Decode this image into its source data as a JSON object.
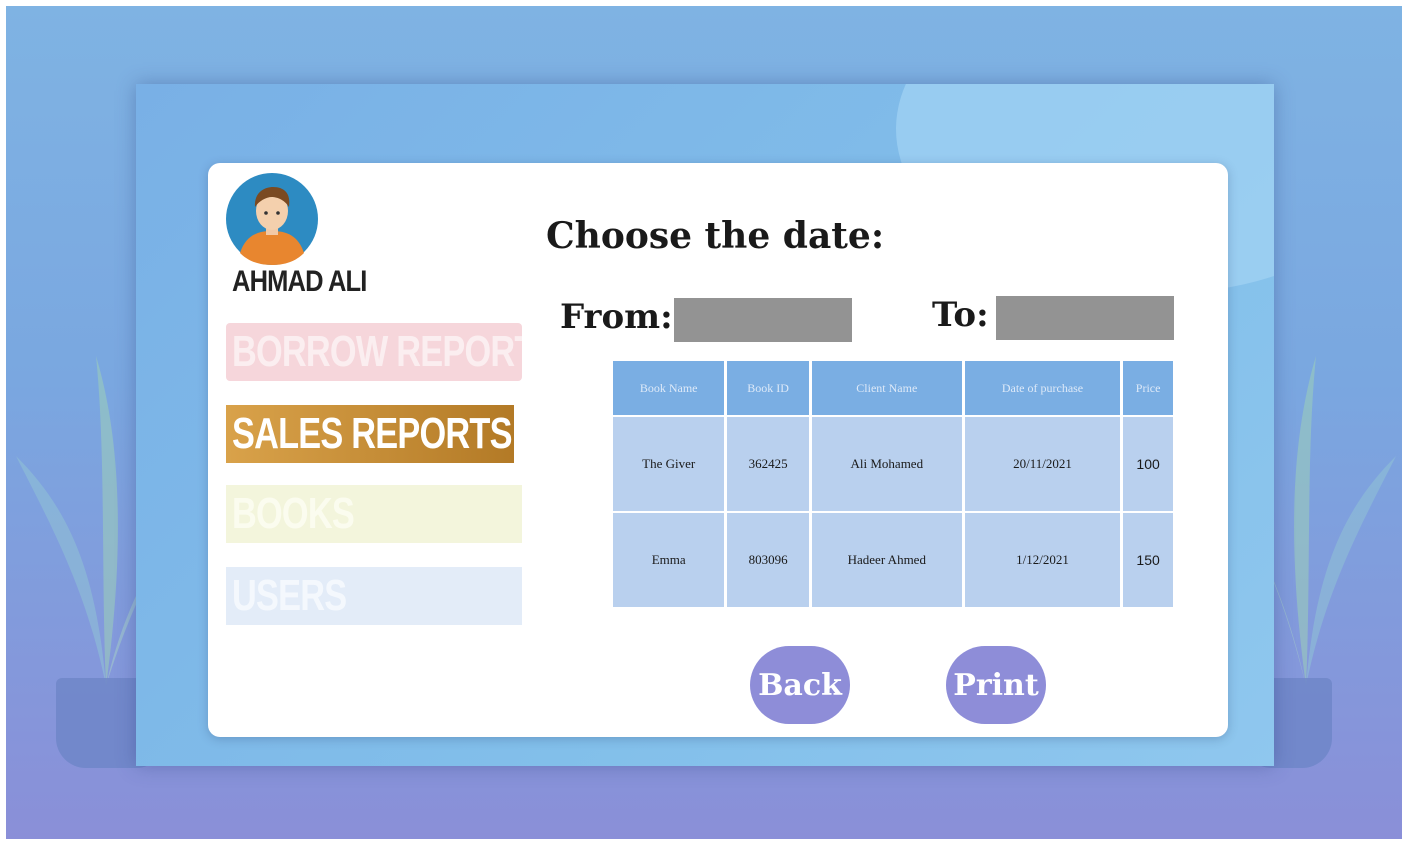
{
  "user": {
    "name": "AHMAD ALI"
  },
  "sidebar": {
    "items": [
      {
        "label": "BORROW REPORTS"
      },
      {
        "label": "SALES REPORTS"
      },
      {
        "label": "BOOKS"
      },
      {
        "label": "USERS"
      }
    ]
  },
  "main": {
    "title": "Choose the date:",
    "from_label": "From:",
    "to_label": "To:",
    "from_value": "",
    "to_value": ""
  },
  "table": {
    "headers": [
      "Book Name",
      "Book ID",
      "Client Name",
      "Date of purchase",
      "Price"
    ],
    "rows": [
      [
        "The Giver",
        "362425",
        "Ali Mohamed",
        "20/11/2021",
        "100"
      ],
      [
        "Emma",
        "803096",
        "Hadeer Ahmed",
        "1/12/2021",
        "150"
      ]
    ]
  },
  "buttons": {
    "back": "Back",
    "print": "Print"
  },
  "colors": {
    "active_menu": "#c28a33",
    "button": "#8e8dd8",
    "table_header": "#7aaee3",
    "table_cell": "#b9d0ee",
    "date_input": "#939393"
  }
}
